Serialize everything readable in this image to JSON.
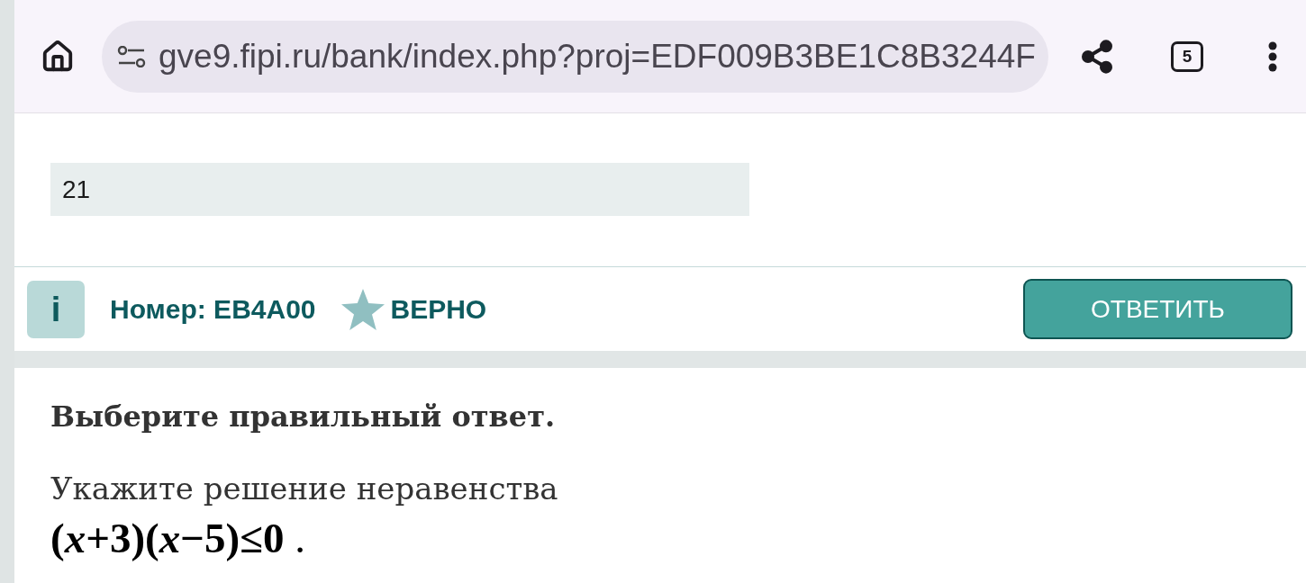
{
  "browser": {
    "url": "gve9.fipi.ru/bank/index.php?proj=EDF009B3BE1C8B3244F",
    "tab_count": "5"
  },
  "answer": {
    "value": "21"
  },
  "task_bar": {
    "info_label": "i",
    "number": "Номер: EB4A00",
    "status": "ВЕРНО",
    "answer_button": "ОТВЕТИТЬ"
  },
  "question": {
    "instruction": "Выберите правильный ответ.",
    "text": "Укажите решение неравенства",
    "formula": "**(*x*+3)(*x*−5)≤0** ."
  }
}
